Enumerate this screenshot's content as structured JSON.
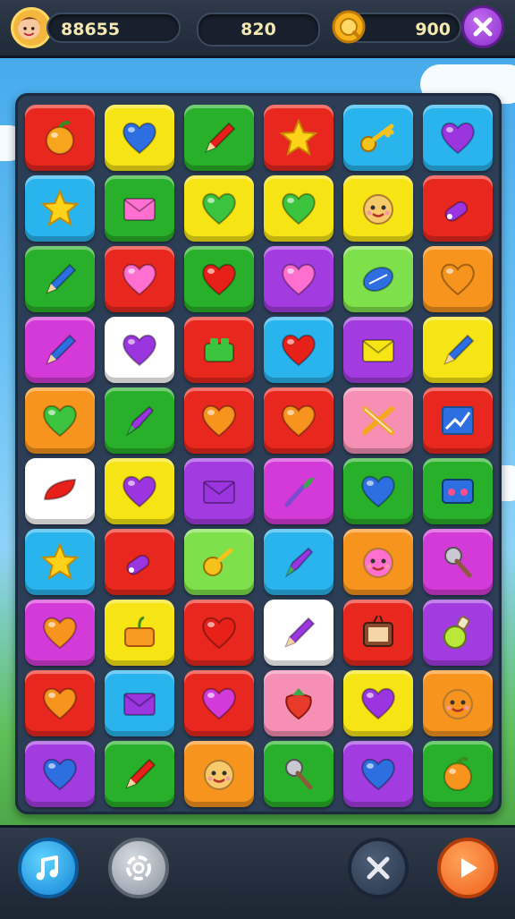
{
  "hud": {
    "score_left": "88655",
    "score_center": "820",
    "score_right": "900"
  },
  "colors": {
    "red": "#e8281f",
    "yellow": "#f6e414",
    "green": "#28b02a",
    "blue": "#2ab4ee",
    "purple": "#a23ce0",
    "orange": "#f7941d",
    "pink": "#f58fb3",
    "white": "#ffffff",
    "lime": "#7ee04a",
    "magenta": "#d43ad8"
  },
  "board": {
    "rows": [
      [
        [
          "red",
          "fruit"
        ],
        [
          "yellow",
          "heart-blue"
        ],
        [
          "green",
          "pencil-red"
        ],
        [
          "red",
          "star"
        ],
        [
          "blue",
          "key"
        ],
        [
          "blue",
          "heart-purple"
        ]
      ],
      [
        [
          "blue",
          "star"
        ],
        [
          "green",
          "envelope-pink"
        ],
        [
          "yellow",
          "heart-green"
        ],
        [
          "yellow",
          "heart-green"
        ],
        [
          "yellow",
          "face"
        ],
        [
          "red",
          "whistle-purple"
        ]
      ],
      [
        [
          "green",
          "pencil-blue"
        ],
        [
          "red",
          "heart-pink"
        ],
        [
          "green",
          "heart-red"
        ],
        [
          "purple",
          "heart-pink"
        ],
        [
          "lime",
          "ball-blue"
        ],
        [
          "orange",
          "heart-orange"
        ]
      ],
      [
        [
          "magenta",
          "pencil-blue"
        ],
        [
          "white",
          "heart-purple"
        ],
        [
          "red",
          "block-green"
        ],
        [
          "blue",
          "heart-red"
        ],
        [
          "purple",
          "envelope-yellow"
        ],
        [
          "yellow",
          "pencil-blue"
        ]
      ],
      [
        [
          "orange",
          "heart-green"
        ],
        [
          "green",
          "rocket-purple"
        ],
        [
          "red",
          "heart-orange"
        ],
        [
          "red",
          "heart-orange"
        ],
        [
          "pink",
          "crossed-pencils"
        ],
        [
          "red",
          "chart-blue"
        ]
      ],
      [
        [
          "white",
          "leaf-red"
        ],
        [
          "yellow",
          "heart-purple"
        ],
        [
          "purple",
          "envelope-purple"
        ],
        [
          "magenta",
          "brush"
        ],
        [
          "green",
          "heart-blue"
        ],
        [
          "green",
          "box-blue"
        ]
      ],
      [
        [
          "blue",
          "star"
        ],
        [
          "red",
          "whistle-purple"
        ],
        [
          "lime",
          "key-yellow"
        ],
        [
          "blue",
          "rocket-purple"
        ],
        [
          "orange",
          "face-pink"
        ],
        [
          "magenta",
          "mic"
        ]
      ],
      [
        [
          "magenta",
          "heart-orange"
        ],
        [
          "yellow",
          "basket"
        ],
        [
          "red",
          "heart-red"
        ],
        [
          "white",
          "pencil-purple"
        ],
        [
          "red",
          "tv"
        ],
        [
          "purple",
          "potion"
        ]
      ],
      [
        [
          "red",
          "heart-orange"
        ],
        [
          "blue",
          "envelope-purple"
        ],
        [
          "red",
          "heart-magenta"
        ],
        [
          "pink",
          "strawberry"
        ],
        [
          "yellow",
          "heart-purple"
        ],
        [
          "orange",
          "face-orange"
        ]
      ],
      [
        [
          "purple",
          "heart-blue"
        ],
        [
          "green",
          "pencil-red"
        ],
        [
          "orange",
          "face"
        ],
        [
          "green",
          "mic"
        ],
        [
          "purple",
          "heart-blue"
        ],
        [
          "green",
          "fruit-orange"
        ]
      ]
    ]
  },
  "buttons": [
    "music-icon",
    "settings-icon",
    "shuffle-icon",
    "play-icon"
  ]
}
